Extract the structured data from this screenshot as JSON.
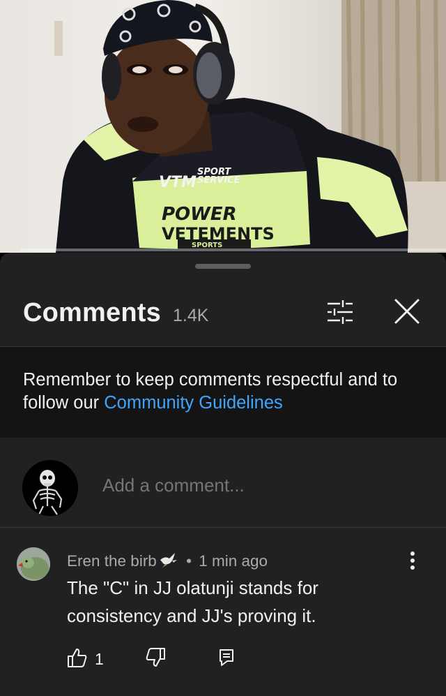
{
  "video": {
    "description_icons": [
      "headphones-icon",
      "bandana-icon"
    ],
    "progress": 0.0
  },
  "comments_panel": {
    "title": "Comments",
    "count": "1.4K",
    "filter_icon": "sliders-icon",
    "close_icon": "close-icon",
    "banner": {
      "text_before": "Remember to keep comments respectful and to follow our ",
      "link": "Community Guidelines"
    },
    "add_comment": {
      "placeholder": "Add a comment..."
    },
    "comments": [
      {
        "author": "Eren the birb",
        "author_emoji": "dove-icon",
        "separator": "•",
        "time": "1 min ago",
        "text": "The \"C\" in JJ olatunji stands for consistency and JJ's proving it.",
        "likes": "1"
      }
    ]
  },
  "colors": {
    "sheet_bg": "#212121",
    "banner_bg": "#141414",
    "link": "#3ea6ff",
    "secondary_text": "#aaaaaa",
    "primary_text": "#f1f1f1"
  }
}
